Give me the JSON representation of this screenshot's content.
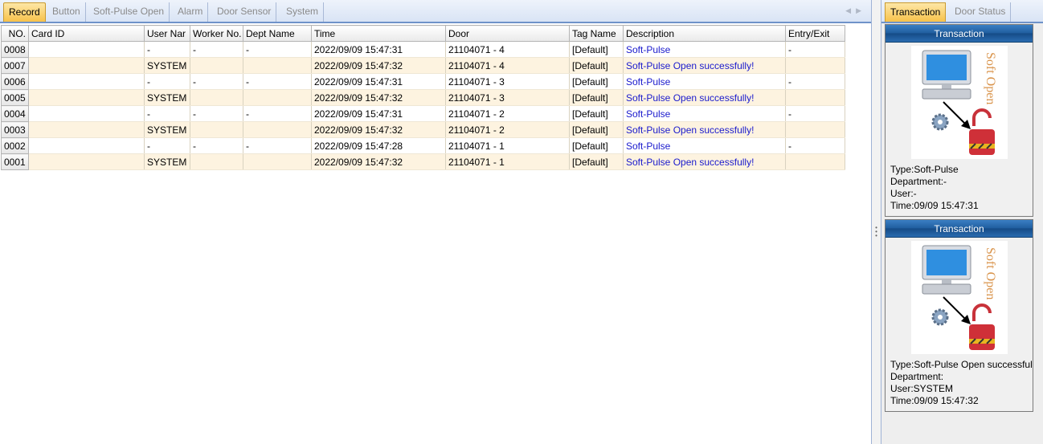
{
  "left_tabs": [
    "Record",
    "Button",
    "Soft-Pulse Open",
    "Alarm",
    "Door Sensor",
    "System"
  ],
  "active_left_tab": "Record",
  "table": {
    "columns": [
      "NO.",
      "Card ID",
      "User Nar",
      "Worker No.",
      "Dept Name",
      "Time",
      "Door",
      "Tag Name",
      "Description",
      "Entry/Exit"
    ],
    "rows": [
      {
        "no": "0008",
        "card_id": "",
        "user": "-",
        "worker": "-",
        "dept": "-",
        "time": "2022/09/09 15:47:31",
        "door": "21104071 - 4",
        "tag": "[Default]",
        "desc": "Soft-Pulse",
        "entry": "-"
      },
      {
        "no": "0007",
        "card_id": "",
        "user": "SYSTEM",
        "worker": "",
        "dept": "",
        "time": "2022/09/09 15:47:32",
        "door": "21104071 - 4",
        "tag": "[Default]",
        "desc": "Soft-Pulse Open successfully!",
        "entry": ""
      },
      {
        "no": "0006",
        "card_id": "",
        "user": "-",
        "worker": "-",
        "dept": "-",
        "time": "2022/09/09 15:47:31",
        "door": "21104071 - 3",
        "tag": "[Default]",
        "desc": "Soft-Pulse",
        "entry": "-"
      },
      {
        "no": "0005",
        "card_id": "",
        "user": "SYSTEM",
        "worker": "",
        "dept": "",
        "time": "2022/09/09 15:47:32",
        "door": "21104071 - 3",
        "tag": "[Default]",
        "desc": "Soft-Pulse Open successfully!",
        "entry": ""
      },
      {
        "no": "0004",
        "card_id": "",
        "user": "-",
        "worker": "-",
        "dept": "-",
        "time": "2022/09/09 15:47:31",
        "door": "21104071 - 2",
        "tag": "[Default]",
        "desc": "Soft-Pulse",
        "entry": "-"
      },
      {
        "no": "0003",
        "card_id": "",
        "user": "SYSTEM",
        "worker": "",
        "dept": "",
        "time": "2022/09/09 15:47:32",
        "door": "21104071 - 2",
        "tag": "[Default]",
        "desc": "Soft-Pulse Open successfully!",
        "entry": ""
      },
      {
        "no": "0002",
        "card_id": "",
        "user": "-",
        "worker": "-",
        "dept": "-",
        "time": "2022/09/09 15:47:28",
        "door": "21104071 - 1",
        "tag": "[Default]",
        "desc": "Soft-Pulse",
        "entry": "-"
      },
      {
        "no": "0001",
        "card_id": "",
        "user": "SYSTEM",
        "worker": "",
        "dept": "",
        "time": "2022/09/09 15:47:32",
        "door": "21104071 - 1",
        "tag": "[Default]",
        "desc": "Soft-Pulse Open successfully!",
        "entry": ""
      }
    ]
  },
  "right_tabs": [
    "Transaction",
    "Door Status"
  ],
  "active_right_tab": "Transaction",
  "cards": [
    {
      "header": "Transaction",
      "image_text": "Soft Open",
      "type": "Type:Soft-Pulse",
      "department": "Department:-",
      "user": "User:-",
      "time": "Time:09/09 15:47:31"
    },
    {
      "header": "Transaction",
      "image_text": "Soft Open",
      "type": "Type:Soft-Pulse Open successfully!",
      "department": "Department:",
      "user": "User:SYSTEM",
      "time": "Time:09/09 15:47:32"
    }
  ],
  "colors": {
    "accent_tab": "#f7c24a",
    "description_link": "#1a1acd",
    "card_header": "#1f5d9e",
    "row_alt": "#fdf3e0"
  },
  "icons": [
    "computer-icon",
    "gear-icon",
    "padlock-open-icon",
    "arrow-icon"
  ]
}
